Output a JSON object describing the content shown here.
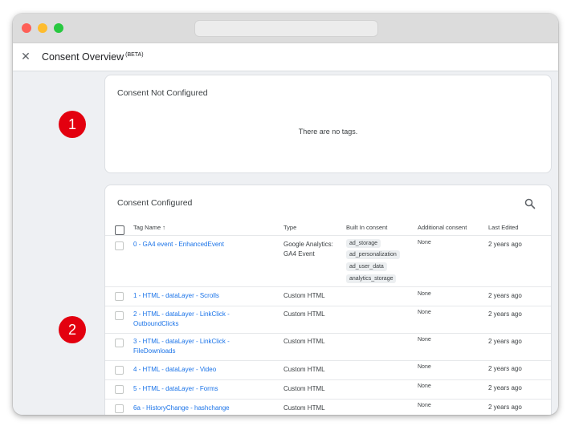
{
  "app": {
    "title": "Consent Overview",
    "badge": "(BETA)"
  },
  "markers": [
    "1",
    "2"
  ],
  "not_configured": {
    "title": "Consent Not Configured",
    "empty_message": "There are no tags."
  },
  "configured": {
    "title": "Consent Configured",
    "columns": {
      "tag_name": "Tag Name",
      "sort_arrow": "↑",
      "type": "Type",
      "built_in": "Built In consent",
      "additional": "Additional consent",
      "last_edited": "Last Edited"
    },
    "rows": [
      {
        "name": "0 - GA4 event - EnhancedEvent",
        "type": "Google Analytics: GA4 Event",
        "built_in": [
          "ad_storage",
          "ad_personalization",
          "ad_user_data",
          "analytics_storage"
        ],
        "additional": "None",
        "edited": "2 years ago"
      },
      {
        "name": "1 - HTML - dataLayer - Scrolls",
        "type": "Custom HTML",
        "built_in": [],
        "additional": "None",
        "edited": "2 years ago"
      },
      {
        "name": "2 - HTML - dataLayer - LinkClick - OutboundClicks",
        "type": "Custom HTML",
        "built_in": [],
        "additional": "None",
        "edited": "2 years ago"
      },
      {
        "name": "3 - HTML - dataLayer - LinkClick - FileDownloads",
        "type": "Custom HTML",
        "built_in": [],
        "additional": "None",
        "edited": "2 years ago"
      },
      {
        "name": "4 - HTML - dataLayer - Video",
        "type": "Custom HTML",
        "built_in": [],
        "additional": "None",
        "edited": "2 years ago"
      },
      {
        "name": "5 - HTML - dataLayer - Forms",
        "type": "Custom HTML",
        "built_in": [],
        "additional": "None",
        "edited": "2 years ago"
      },
      {
        "name": "6a - HistoryChange - hashchange",
        "type": "Custom HTML",
        "built_in": [],
        "additional": "None",
        "edited": "2 years ago"
      }
    ]
  },
  "icons": {
    "close": "close-icon",
    "search": "search-icon",
    "sort": "arrow-up-icon"
  }
}
